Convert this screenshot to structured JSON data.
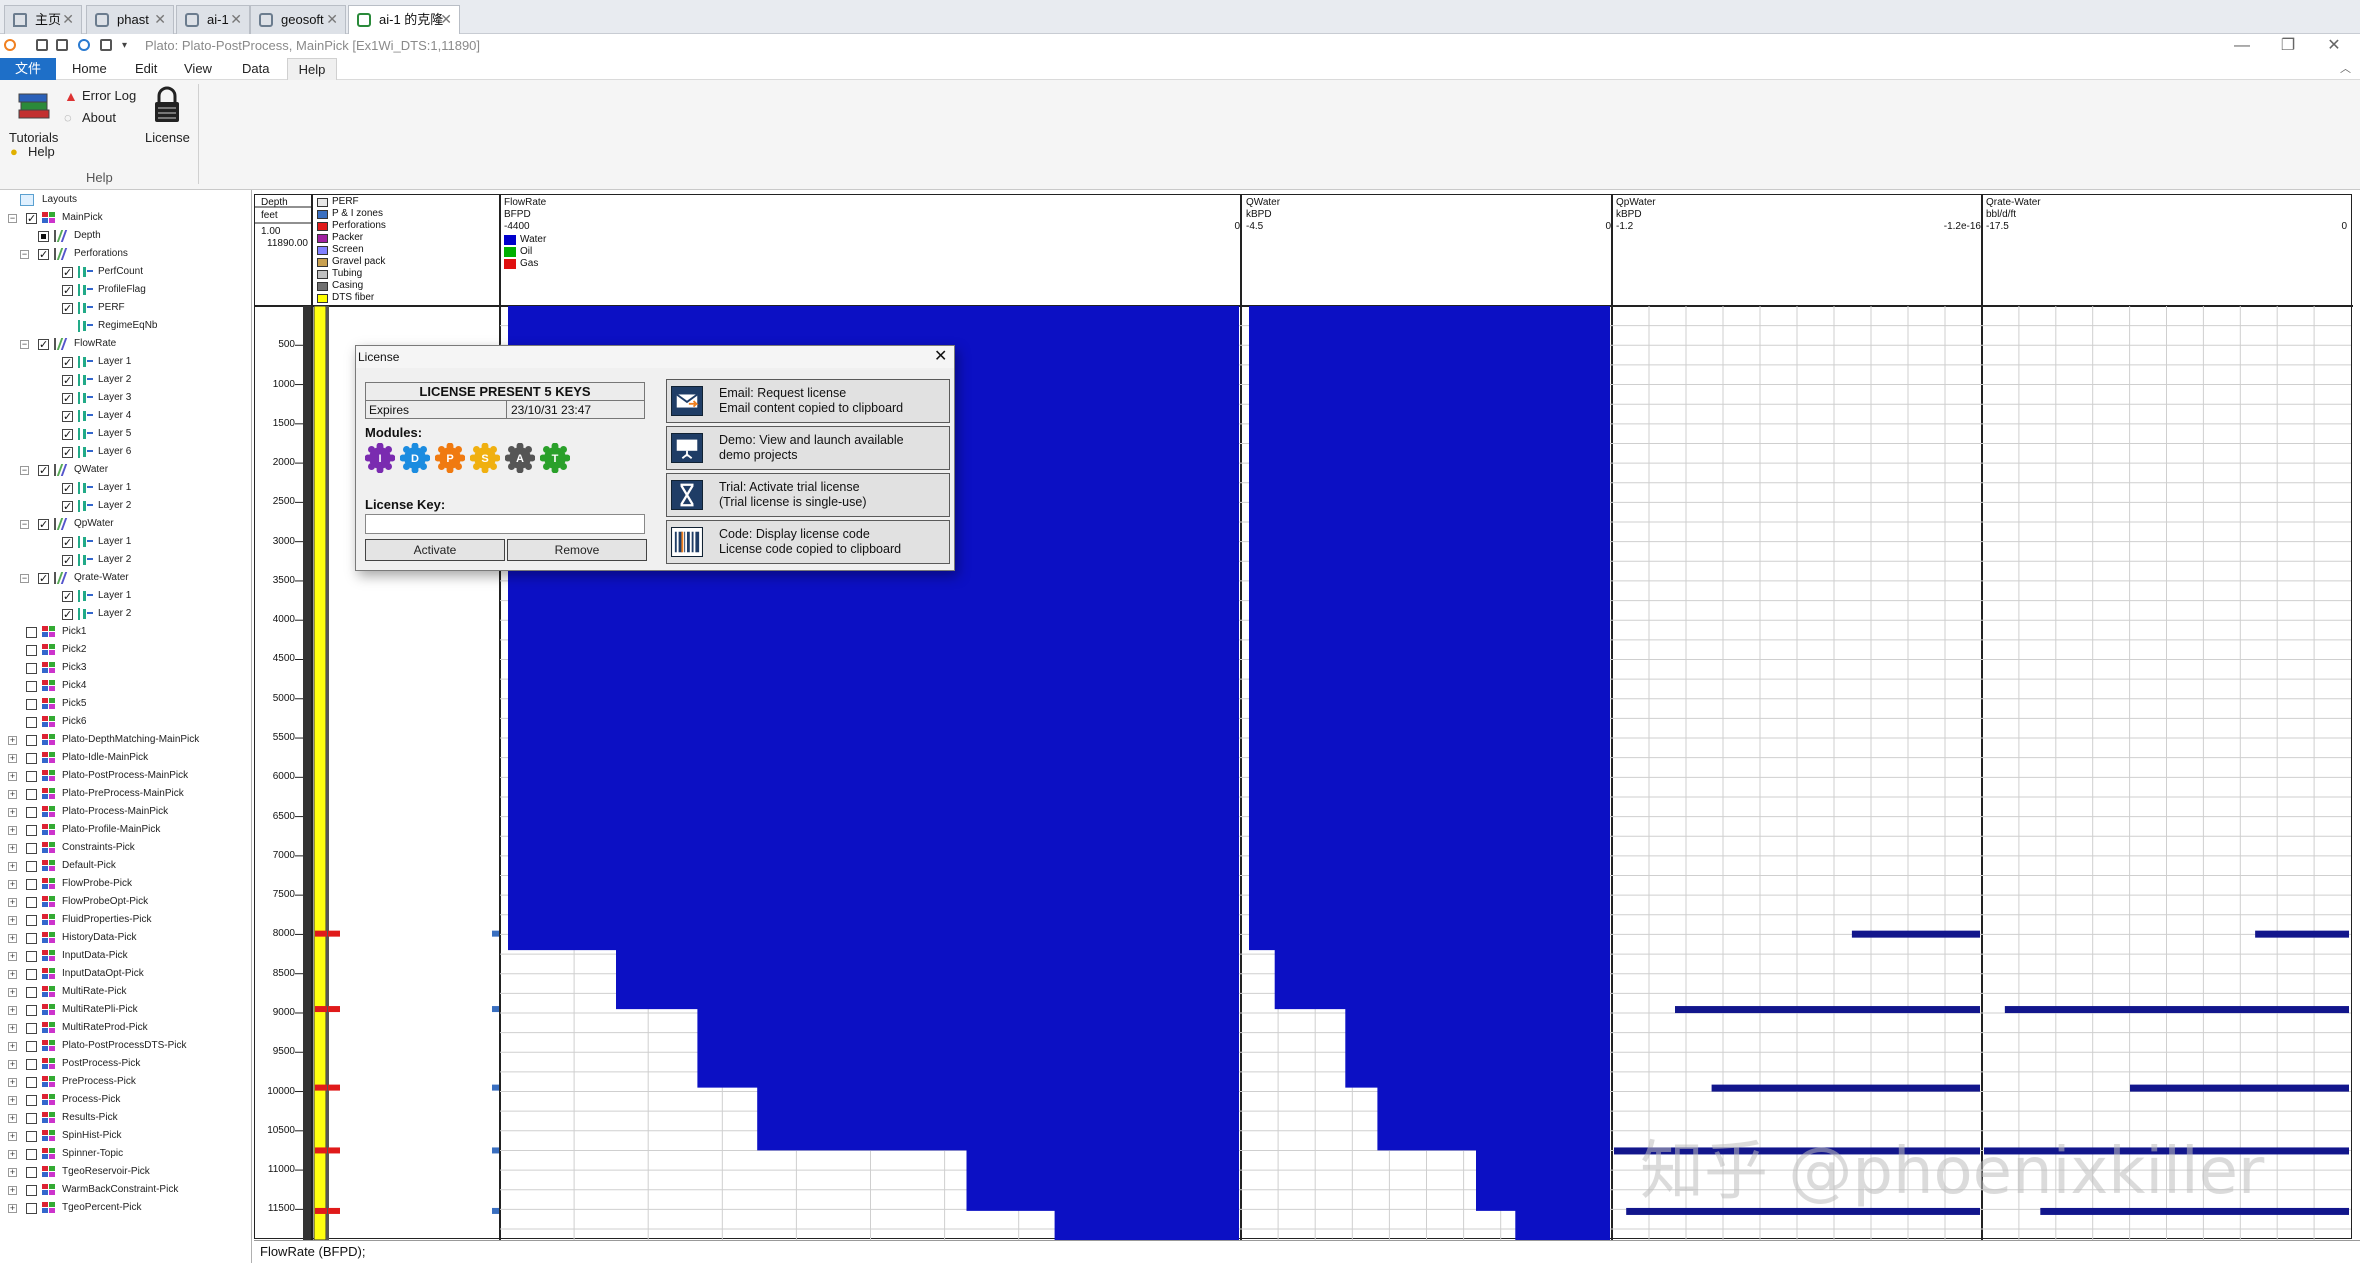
{
  "browser_tabs": [
    {
      "label": "主页",
      "active": false
    },
    {
      "label": "phast",
      "active": false
    },
    {
      "label": "ai-1",
      "active": false
    },
    {
      "label": "geosoft",
      "active": false
    },
    {
      "label": "ai-1 的克隆",
      "active": true
    }
  ],
  "window": {
    "title": "Plato: Plato-PostProcess, MainPick [Ex1Wi_DTS:1,11890]"
  },
  "menus": [
    "文件",
    "Home",
    "Edit",
    "View",
    "Data",
    "Help"
  ],
  "ribbon": {
    "tutorials": "Tutorials",
    "error_log": "Error Log",
    "about": "About",
    "help": "Help",
    "license": "License",
    "group_label": "Help"
  },
  "tree": {
    "root": "Layouts",
    "items": [
      {
        "label": "MainPick",
        "level": 1,
        "expander": "−",
        "checked": true
      },
      {
        "label": "Depth",
        "level": 2,
        "expander": "",
        "checked": null
      },
      {
        "label": "Perforations",
        "level": 2,
        "expander": "−",
        "checked": true
      },
      {
        "label": "PerfCount",
        "level": 3,
        "expander": "",
        "checked": true
      },
      {
        "label": "ProfileFlag",
        "level": 3,
        "expander": "",
        "checked": true
      },
      {
        "label": "PERF",
        "level": 3,
        "expander": "",
        "checked": true
      },
      {
        "label": "RegimeEqNb",
        "level": 3,
        "expander": "",
        "checked": null
      },
      {
        "label": "FlowRate",
        "level": 2,
        "expander": "−",
        "checked": true
      },
      {
        "label": "Layer 1",
        "level": 3,
        "expander": "",
        "checked": true
      },
      {
        "label": "Layer 2",
        "level": 3,
        "expander": "",
        "checked": true
      },
      {
        "label": "Layer 3",
        "level": 3,
        "expander": "",
        "checked": true
      },
      {
        "label": "Layer 4",
        "level": 3,
        "expander": "",
        "checked": true
      },
      {
        "label": "Layer 5",
        "level": 3,
        "expander": "",
        "checked": true
      },
      {
        "label": "Layer 6",
        "level": 3,
        "expander": "",
        "checked": true
      },
      {
        "label": "QWater",
        "level": 2,
        "expander": "−",
        "checked": true
      },
      {
        "label": "Layer 1",
        "level": 3,
        "expander": "",
        "checked": true
      },
      {
        "label": "Layer 2",
        "level": 3,
        "expander": "",
        "checked": true
      },
      {
        "label": "QpWater",
        "level": 2,
        "expander": "−",
        "checked": true
      },
      {
        "label": "Layer 1",
        "level": 3,
        "expander": "",
        "checked": true
      },
      {
        "label": "Layer 2",
        "level": 3,
        "expander": "",
        "checked": true
      },
      {
        "label": "Qrate-Water",
        "level": 2,
        "expander": "−",
        "checked": true
      },
      {
        "label": "Layer 1",
        "level": 3,
        "expander": "",
        "checked": true
      },
      {
        "label": "Layer 2",
        "level": 3,
        "expander": "",
        "checked": true
      },
      {
        "label": "Pick1",
        "level": 1,
        "expander": "",
        "checked": false
      },
      {
        "label": "Pick2",
        "level": 1,
        "expander": "",
        "checked": false
      },
      {
        "label": "Pick3",
        "level": 1,
        "expander": "",
        "checked": false
      },
      {
        "label": "Pick4",
        "level": 1,
        "expander": "",
        "checked": false
      },
      {
        "label": "Pick5",
        "level": 1,
        "expander": "",
        "checked": false
      },
      {
        "label": "Pick6",
        "level": 1,
        "expander": "",
        "checked": false
      },
      {
        "label": "Plato-DepthMatching-MainPick",
        "level": 1,
        "expander": "+",
        "checked": false
      },
      {
        "label": "Plato-Idle-MainPick",
        "level": 1,
        "expander": "+",
        "checked": false
      },
      {
        "label": "Plato-PostProcess-MainPick",
        "level": 1,
        "expander": "+",
        "checked": false
      },
      {
        "label": "Plato-PreProcess-MainPick",
        "level": 1,
        "expander": "+",
        "checked": false
      },
      {
        "label": "Plato-Process-MainPick",
        "level": 1,
        "expander": "+",
        "checked": false
      },
      {
        "label": "Plato-Profile-MainPick",
        "level": 1,
        "expander": "+",
        "checked": false
      },
      {
        "label": "Constraints-Pick",
        "level": 1,
        "expander": "+",
        "checked": false
      },
      {
        "label": "Default-Pick",
        "level": 1,
        "expander": "+",
        "checked": false
      },
      {
        "label": "FlowProbe-Pick",
        "level": 1,
        "expander": "+",
        "checked": false
      },
      {
        "label": "FlowProbeOpt-Pick",
        "level": 1,
        "expander": "+",
        "checked": false
      },
      {
        "label": "FluidProperties-Pick",
        "level": 1,
        "expander": "+",
        "checked": false
      },
      {
        "label": "HistoryData-Pick",
        "level": 1,
        "expander": "+",
        "checked": false
      },
      {
        "label": "InputData-Pick",
        "level": 1,
        "expander": "+",
        "checked": false
      },
      {
        "label": "InputDataOpt-Pick",
        "level": 1,
        "expander": "+",
        "checked": false
      },
      {
        "label": "MultiRate-Pick",
        "level": 1,
        "expander": "+",
        "checked": false
      },
      {
        "label": "MultiRatePli-Pick",
        "level": 1,
        "expander": "+",
        "checked": false
      },
      {
        "label": "MultiRateProd-Pick",
        "level": 1,
        "expander": "+",
        "checked": false
      },
      {
        "label": "Plato-PostProcessDTS-Pick",
        "level": 1,
        "expander": "+",
        "checked": false
      },
      {
        "label": "PostProcess-Pick",
        "level": 1,
        "expander": "+",
        "checked": false
      },
      {
        "label": "PreProcess-Pick",
        "level": 1,
        "expander": "+",
        "checked": false
      },
      {
        "label": "Process-Pick",
        "level": 1,
        "expander": "+",
        "checked": false
      },
      {
        "label": "Results-Pick",
        "level": 1,
        "expander": "+",
        "checked": false
      },
      {
        "label": "SpinHist-Pick",
        "level": 1,
        "expander": "+",
        "checked": false
      },
      {
        "label": "Spinner-Topic",
        "level": 1,
        "expander": "+",
        "checked": false
      },
      {
        "label": "TgeoReservoir-Pick",
        "level": 1,
        "expander": "+",
        "checked": false
      },
      {
        "label": "WarmBackConstraint-Pick",
        "level": 1,
        "expander": "+",
        "checked": false
      },
      {
        "label": "TgeoPercent-Pick",
        "level": 1,
        "expander": "+",
        "checked": false
      }
    ]
  },
  "tracks": {
    "depth": {
      "title": "Depth",
      "unit": "feet",
      "scale": "1.00",
      "top": "11890.00"
    },
    "perf_legend": [
      {
        "label": "PERF",
        "color": "#e8e8e8"
      },
      {
        "label": "P & I zones",
        "color": "#3a6fc0"
      },
      {
        "label": "Perforations",
        "color": "#e01a1a"
      },
      {
        "label": "Packer",
        "color": "#a020a0"
      },
      {
        "label": "Screen",
        "color": "#8080ff"
      },
      {
        "label": "Gravel pack",
        "color": "#c8a050"
      },
      {
        "label": "Tubing",
        "color": "#c0c0c0"
      },
      {
        "label": "Casing",
        "color": "#707070"
      },
      {
        "label": "DTS fiber",
        "color": "#ffff00"
      }
    ],
    "flowrate": {
      "title": "FlowRate",
      "unit": "BFPD",
      "min": "-4400",
      "max": "0",
      "legend": [
        {
          "label": "Water",
          "color": "#0000cc"
        },
        {
          "label": "Oil",
          "color": "#00b000"
        },
        {
          "label": "Gas",
          "color": "#e01010"
        }
      ]
    },
    "qwater": {
      "title": "QWater",
      "unit": "kBPD",
      "min": "-4.5",
      "max": "0"
    },
    "qpwater": {
      "title": "QpWater",
      "unit": "kBPD",
      "min": "-1.2",
      "max": "-1.2e-16"
    },
    "qrate": {
      "title": "Qrate-Water",
      "unit": "bbl/d/ft",
      "min": "-17.5",
      "max": "0"
    }
  },
  "depth_ticks": [
    "500",
    "1000",
    "1500",
    "2000",
    "2500",
    "3000",
    "3500",
    "4000",
    "4500",
    "5000",
    "5500",
    "6000",
    "6500",
    "7000",
    "7500",
    "8000",
    "8500",
    "9000",
    "9500",
    "10000",
    "10500",
    "11000",
    "11500"
  ],
  "dialog": {
    "title": "License",
    "status": "LICENSE PRESENT 5 KEYS",
    "expires_label": "Expires",
    "expires_value": "23/10/31 23:47",
    "modules_label": "Modules:",
    "modules": [
      {
        "letter": "I",
        "color": "#7a2bb0"
      },
      {
        "letter": "D",
        "color": "#1b8ce0"
      },
      {
        "letter": "P",
        "color": "#f07a10"
      },
      {
        "letter": "S",
        "color": "#f0b010"
      },
      {
        "letter": "A",
        "color": "#555555"
      },
      {
        "letter": "T",
        "color": "#2aa02a"
      }
    ],
    "license_key_label": "License Key:",
    "license_key_value": "",
    "activate": "Activate",
    "remove": "Remove",
    "actions": [
      {
        "line1": "Email: Request license",
        "line2": "Email content copied to clipboard",
        "icon": "envelope-icon"
      },
      {
        "line1": "Demo: View and launch available",
        "line2": "demo projects",
        "icon": "presentation-icon"
      },
      {
        "line1": "Trial: Activate trial license",
        "line2": "(Trial license is single-use)",
        "icon": "hourglass-icon"
      },
      {
        "line1": "Code: Display license code",
        "line2": "License code copied to clipboard",
        "icon": "barcode-icon"
      }
    ]
  },
  "status_bar": "FlowRate (BFPD);",
  "watermark": "知乎 @phoenixkiller",
  "chart_data": [
    {
      "type": "area",
      "title": "FlowRate",
      "ylabel": "Depth (feet)",
      "xlabel": "BFPD",
      "xlim": [
        -4400,
        0
      ],
      "ylim": [
        0,
        11890
      ],
      "series": [
        {
          "name": "Water",
          "depth": [
            0,
            7990,
            8200,
            8950,
            9950,
            10750,
            11520,
            11890
          ],
          "x": [
            -4400,
            -4400,
            -3750,
            -3260,
            -2900,
            -1640,
            -1110,
            -1110
          ]
        }
      ]
    },
    {
      "type": "area",
      "title": "QWater",
      "ylabel": "Depth (feet)",
      "xlabel": "kBPD",
      "xlim": [
        -4.5,
        0
      ],
      "ylim": [
        0,
        11890
      ],
      "series": [
        {
          "depth": [
            0,
            7990,
            8200,
            8950,
            9950,
            10750,
            11520,
            11890
          ],
          "x": [
            -4.5,
            -4.5,
            -4.18,
            -3.3,
            -2.9,
            -1.67,
            -1.18,
            -1.18
          ]
        }
      ]
    },
    {
      "type": "bar",
      "title": "QpWater",
      "xlabel": "kBPD",
      "xlim": [
        -1.2,
        0
      ],
      "depths": [
        7990,
        8950,
        9950,
        10750,
        11520
      ],
      "values": [
        -0.42,
        -1.0,
        -0.88,
        -1.2,
        -1.16
      ]
    },
    {
      "type": "bar",
      "title": "Qrate-Water",
      "xlabel": "bbl/d/ft",
      "xlim": [
        -17.5,
        0
      ],
      "depths": [
        7990,
        8950,
        9950,
        10750,
        11520
      ],
      "values": [
        -4.5,
        -16.5,
        -10.5,
        -17.5,
        -14.8
      ]
    }
  ]
}
